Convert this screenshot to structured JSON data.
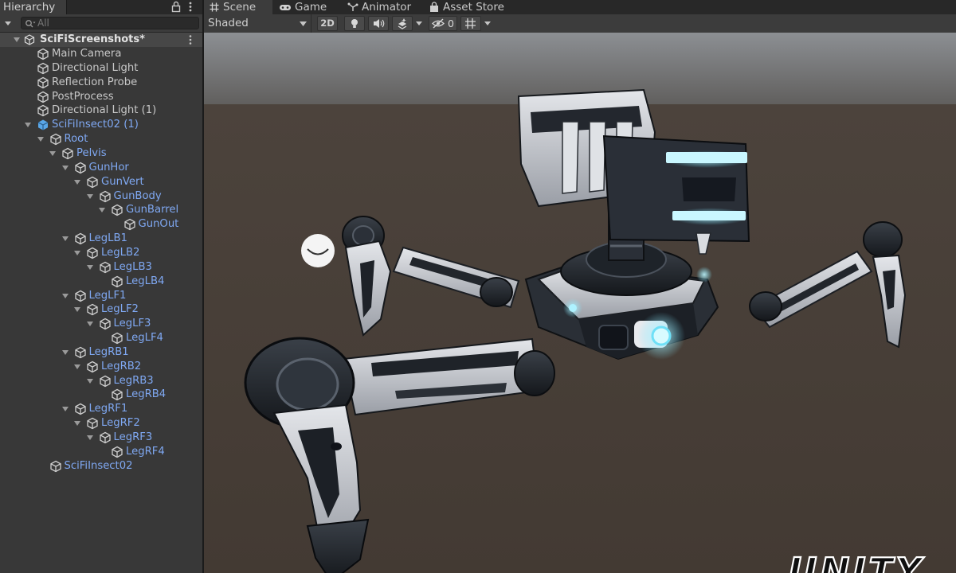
{
  "hierarchy": {
    "tab_title": "Hierarchy",
    "search_placeholder": "All",
    "scene_name": "SciFiScreenshots*",
    "rows": [
      {
        "label": "Main Camera",
        "depth": 0,
        "arrow": "none",
        "prefab": false
      },
      {
        "label": "Directional Light",
        "depth": 0,
        "arrow": "none",
        "prefab": false
      },
      {
        "label": "Reflection Probe",
        "depth": 0,
        "arrow": "none",
        "prefab": false
      },
      {
        "label": "PostProcess",
        "depth": 0,
        "arrow": "none",
        "prefab": false
      },
      {
        "label": "Directional Light (1)",
        "depth": 0,
        "arrow": "none",
        "prefab": false
      },
      {
        "label": "SciFiInsect02 (1)",
        "depth": 0,
        "arrow": "open",
        "prefab": true,
        "root": true
      },
      {
        "label": "Root",
        "depth": 1,
        "arrow": "open",
        "prefab": true
      },
      {
        "label": "Pelvis",
        "depth": 2,
        "arrow": "open",
        "prefab": true
      },
      {
        "label": "GunHor",
        "depth": 3,
        "arrow": "open",
        "prefab": true
      },
      {
        "label": "GunVert",
        "depth": 4,
        "arrow": "open",
        "prefab": true
      },
      {
        "label": "GunBody",
        "depth": 5,
        "arrow": "open",
        "prefab": true
      },
      {
        "label": "GunBarrel",
        "depth": 6,
        "arrow": "open",
        "prefab": true
      },
      {
        "label": "GunOut",
        "depth": 7,
        "arrow": "none",
        "prefab": true
      },
      {
        "label": "LegLB1",
        "depth": 3,
        "arrow": "open",
        "prefab": true
      },
      {
        "label": "LegLB2",
        "depth": 4,
        "arrow": "open",
        "prefab": true
      },
      {
        "label": "LegLB3",
        "depth": 5,
        "arrow": "open",
        "prefab": true
      },
      {
        "label": "LegLB4",
        "depth": 6,
        "arrow": "none",
        "prefab": true
      },
      {
        "label": "LegLF1",
        "depth": 3,
        "arrow": "open",
        "prefab": true
      },
      {
        "label": "LegLF2",
        "depth": 4,
        "arrow": "open",
        "prefab": true
      },
      {
        "label": "LegLF3",
        "depth": 5,
        "arrow": "open",
        "prefab": true
      },
      {
        "label": "LegLF4",
        "depth": 6,
        "arrow": "none",
        "prefab": true
      },
      {
        "label": "LegRB1",
        "depth": 3,
        "arrow": "open",
        "prefab": true
      },
      {
        "label": "LegRB2",
        "depth": 4,
        "arrow": "open",
        "prefab": true
      },
      {
        "label": "LegRB3",
        "depth": 5,
        "arrow": "open",
        "prefab": true
      },
      {
        "label": "LegRB4",
        "depth": 6,
        "arrow": "none",
        "prefab": true
      },
      {
        "label": "LegRF1",
        "depth": 3,
        "arrow": "open",
        "prefab": true
      },
      {
        "label": "LegRF2",
        "depth": 4,
        "arrow": "open",
        "prefab": true
      },
      {
        "label": "LegRF3",
        "depth": 5,
        "arrow": "open",
        "prefab": true
      },
      {
        "label": "LegRF4",
        "depth": 6,
        "arrow": "none",
        "prefab": true
      },
      {
        "label": "SciFiInsect02",
        "depth": 1,
        "arrow": "none",
        "prefab": true
      }
    ]
  },
  "scene_tabs": [
    {
      "label": "Scene",
      "icon": "hash-icon",
      "active": true
    },
    {
      "label": "Game",
      "icon": "gamepad-icon",
      "active": false
    },
    {
      "label": "Animator",
      "icon": "animator-icon",
      "active": false
    },
    {
      "label": "Asset Store",
      "icon": "shopping-bag-icon",
      "active": false
    }
  ],
  "scene_toolbar": {
    "shading_mode": "Shaded",
    "mode_2d_label": "2D",
    "hidden_count": "0",
    "icons": [
      "lightbulb-icon",
      "speaker-icon",
      "effects-icon",
      "visibility-icon",
      "grid-icon"
    ]
  },
  "watermark": "UNITY",
  "colors": {
    "prefab_text": "#7fa8f2",
    "panel_bg": "#383838",
    "selected_row": "#474747",
    "glow": "#7fe8ff",
    "ground": "#4a4039"
  }
}
